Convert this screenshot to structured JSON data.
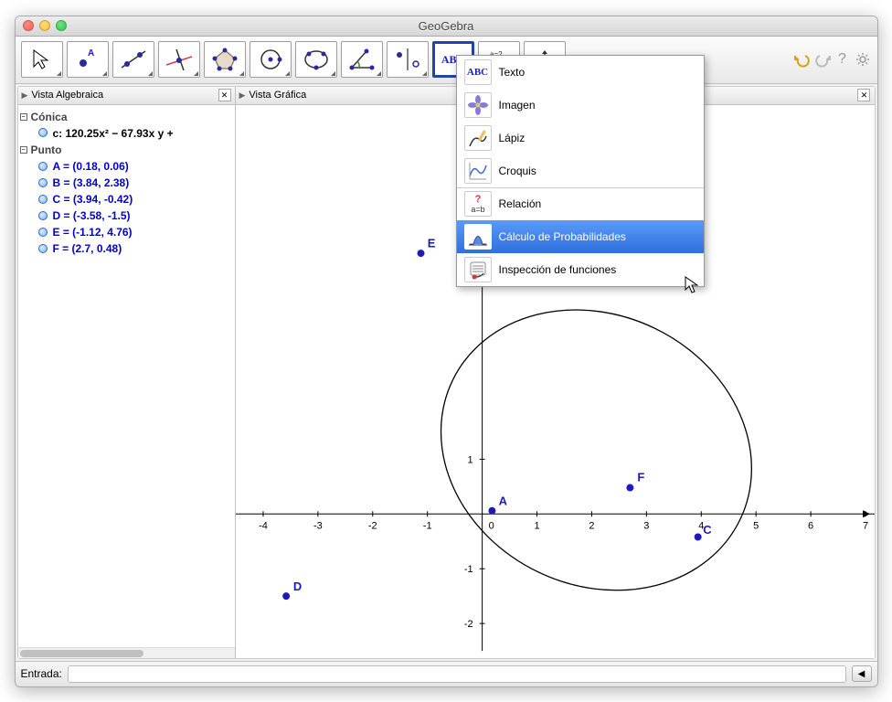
{
  "window": {
    "title": "GeoGebra"
  },
  "inputbar": {
    "label": "Entrada:",
    "value": ""
  },
  "sidebar": {
    "title": "Vista Algebraica",
    "categories": [
      {
        "name": "Cónica",
        "items": [
          {
            "type": "conic",
            "label": "c: 120.25x² − 67.93x y +"
          }
        ]
      },
      {
        "name": "Punto",
        "items": [
          {
            "type": "point",
            "label": "A = (0.18, 0.06)"
          },
          {
            "type": "point",
            "label": "B = (3.84, 2.38)"
          },
          {
            "type": "point",
            "label": "C = (3.94, -0.42)"
          },
          {
            "type": "point",
            "label": "D = (-3.58, -1.5)"
          },
          {
            "type": "point",
            "label": "E = (-1.12, 4.76)"
          },
          {
            "type": "point",
            "label": "F = (2.7, 0.48)"
          }
        ]
      }
    ]
  },
  "graphics": {
    "title": "Vista Gráfica"
  },
  "dropdown": {
    "items": [
      {
        "id": "text",
        "label": "Texto",
        "icon": "ABC"
      },
      {
        "id": "image",
        "label": "Imagen"
      },
      {
        "id": "pencil",
        "label": "Lápiz"
      },
      {
        "id": "sketch",
        "label": "Croquis"
      },
      {
        "id": "relation",
        "label": "Relación",
        "sep": true
      },
      {
        "id": "prob",
        "label": "Cálculo de Probabilidades",
        "highlight": true
      },
      {
        "id": "inspect",
        "label": "Inspección de funciones"
      }
    ]
  },
  "toolbar_selected_label": "ABC",
  "slider_label": "a=2",
  "chart_data": {
    "type": "scatter",
    "title": "",
    "xlabel": "",
    "ylabel": "",
    "xlim": [
      -4.5,
      7.2
    ],
    "ylim": [
      -2.6,
      5.2
    ],
    "points": [
      {
        "name": "A",
        "x": 0.18,
        "y": 0.06
      },
      {
        "name": "B",
        "x": 3.84,
        "y": 2.38
      },
      {
        "name": "C",
        "x": 3.94,
        "y": -0.42
      },
      {
        "name": "D",
        "x": -3.58,
        "y": -1.5
      },
      {
        "name": "E",
        "x": -1.12,
        "y": 4.76
      },
      {
        "name": "F",
        "x": 2.7,
        "y": 0.48
      }
    ],
    "conic": "120.25x² − 67.93x y + ..."
  }
}
